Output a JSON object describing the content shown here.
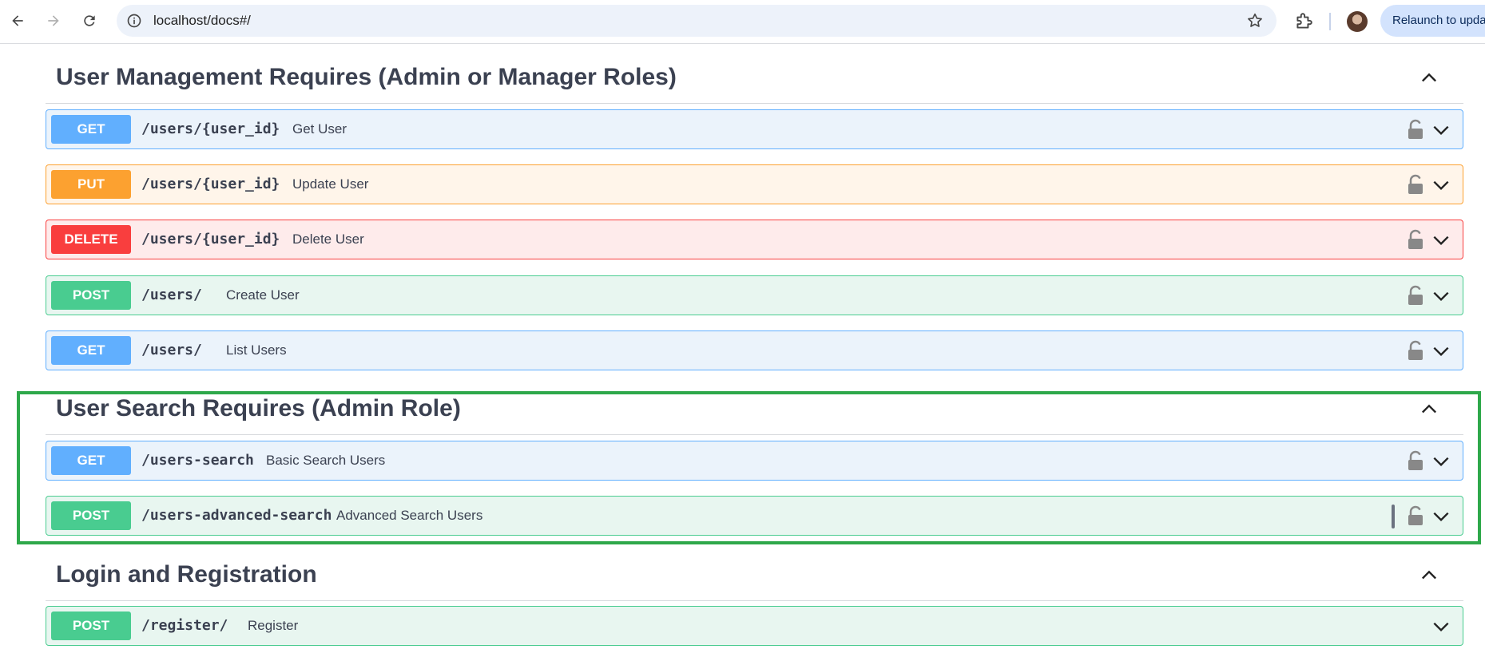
{
  "browser": {
    "url": "localhost/docs#/",
    "relaunch_label": "Relaunch to update",
    "icons": [
      "back-icon",
      "forward-icon",
      "reload-icon",
      "info-icon",
      "star-icon",
      "extensions-icon"
    ]
  },
  "sections": [
    {
      "title": "User Management Requires (Admin or Manager Roles)",
      "operations": [
        {
          "method": "GET",
          "path": "/users/{user_id}",
          "summary": "Get User"
        },
        {
          "method": "PUT",
          "path": "/users/{user_id}",
          "summary": "Update User"
        },
        {
          "method": "DELETE",
          "path": "/users/{user_id}",
          "summary": "Delete User"
        },
        {
          "method": "POST",
          "path": "/users/",
          "summary": "Create User"
        },
        {
          "method": "GET",
          "path": "/users/",
          "summary": "List Users"
        }
      ]
    },
    {
      "title": "User Search Requires (Admin Role)",
      "operations": [
        {
          "method": "GET",
          "path": "/users-search",
          "summary": "Basic Search Users"
        },
        {
          "method": "POST",
          "path": "/users-advanced-search",
          "summary": "Advanced Search Users"
        }
      ]
    },
    {
      "title": "Login and Registration",
      "operations": [
        {
          "method": "POST",
          "path": "/register/",
          "summary": "Register"
        }
      ]
    }
  ],
  "colors": {
    "get": "#61affe",
    "put": "#fca130",
    "delete": "#f93e3e",
    "post": "#49cc90",
    "highlight": "#2ea84a"
  }
}
